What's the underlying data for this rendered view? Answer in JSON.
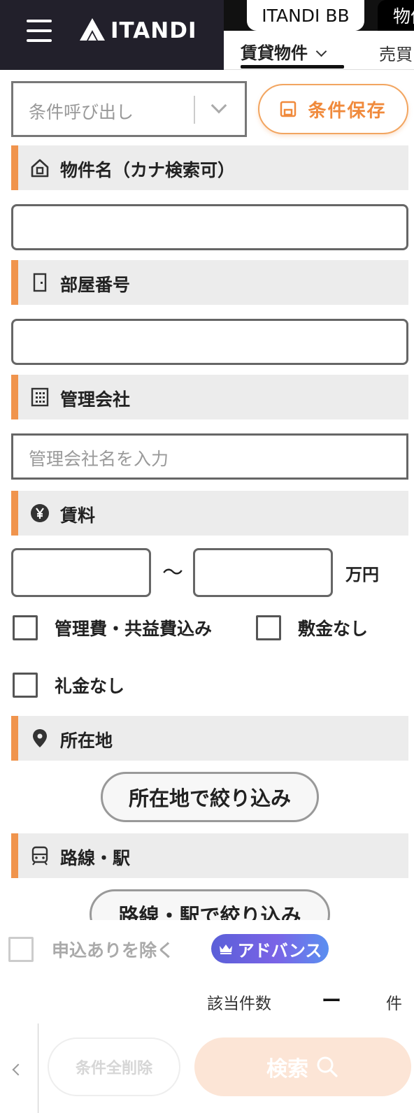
{
  "header": {
    "logo_text": "ITANDI",
    "tabs": [
      {
        "label": "ITANDI BB",
        "active": true
      },
      {
        "label": "物件",
        "active": false
      }
    ],
    "subnav": [
      {
        "label": "賃貸物件",
        "active": true
      },
      {
        "label": "売買",
        "active": false
      }
    ]
  },
  "saved_conditions": {
    "select_placeholder": "条件呼び出し",
    "save_button_label": "条件保存"
  },
  "sections": {
    "property_name": {
      "title": "物件名（カナ検索可）",
      "value": ""
    },
    "room_number": {
      "title": "部屋番号",
      "value": ""
    },
    "management_company": {
      "title": "管理会社",
      "placeholder": "管理会社名を入力"
    },
    "rent": {
      "title": "賃料",
      "min_value": "",
      "max_value": "",
      "separator": "〜",
      "unit": "万円",
      "options": [
        {
          "label": "管理費・共益費込み",
          "checked": false
        },
        {
          "label": "敷金なし",
          "checked": false
        },
        {
          "label": "礼金なし",
          "checked": false
        }
      ]
    },
    "location": {
      "title": "所在地",
      "button_label": "所在地で絞り込み"
    },
    "line_station": {
      "title": "路線・駅",
      "button_label": "路線・駅で絞り込み"
    }
  },
  "footer": {
    "exclude_applied_label": "申込ありを除く",
    "exclude_applied_checked": false,
    "advance_badge": "アドバンス",
    "count_label": "該当件数",
    "count_value": "ー",
    "count_unit": "件",
    "clear_all_label": "条件全削除",
    "search_label": "検索"
  },
  "colors": {
    "accent_orange": "#f0944d",
    "header_dark": "#22202b",
    "section_bg": "#ececec",
    "advance_badge": "#6a62e0"
  }
}
